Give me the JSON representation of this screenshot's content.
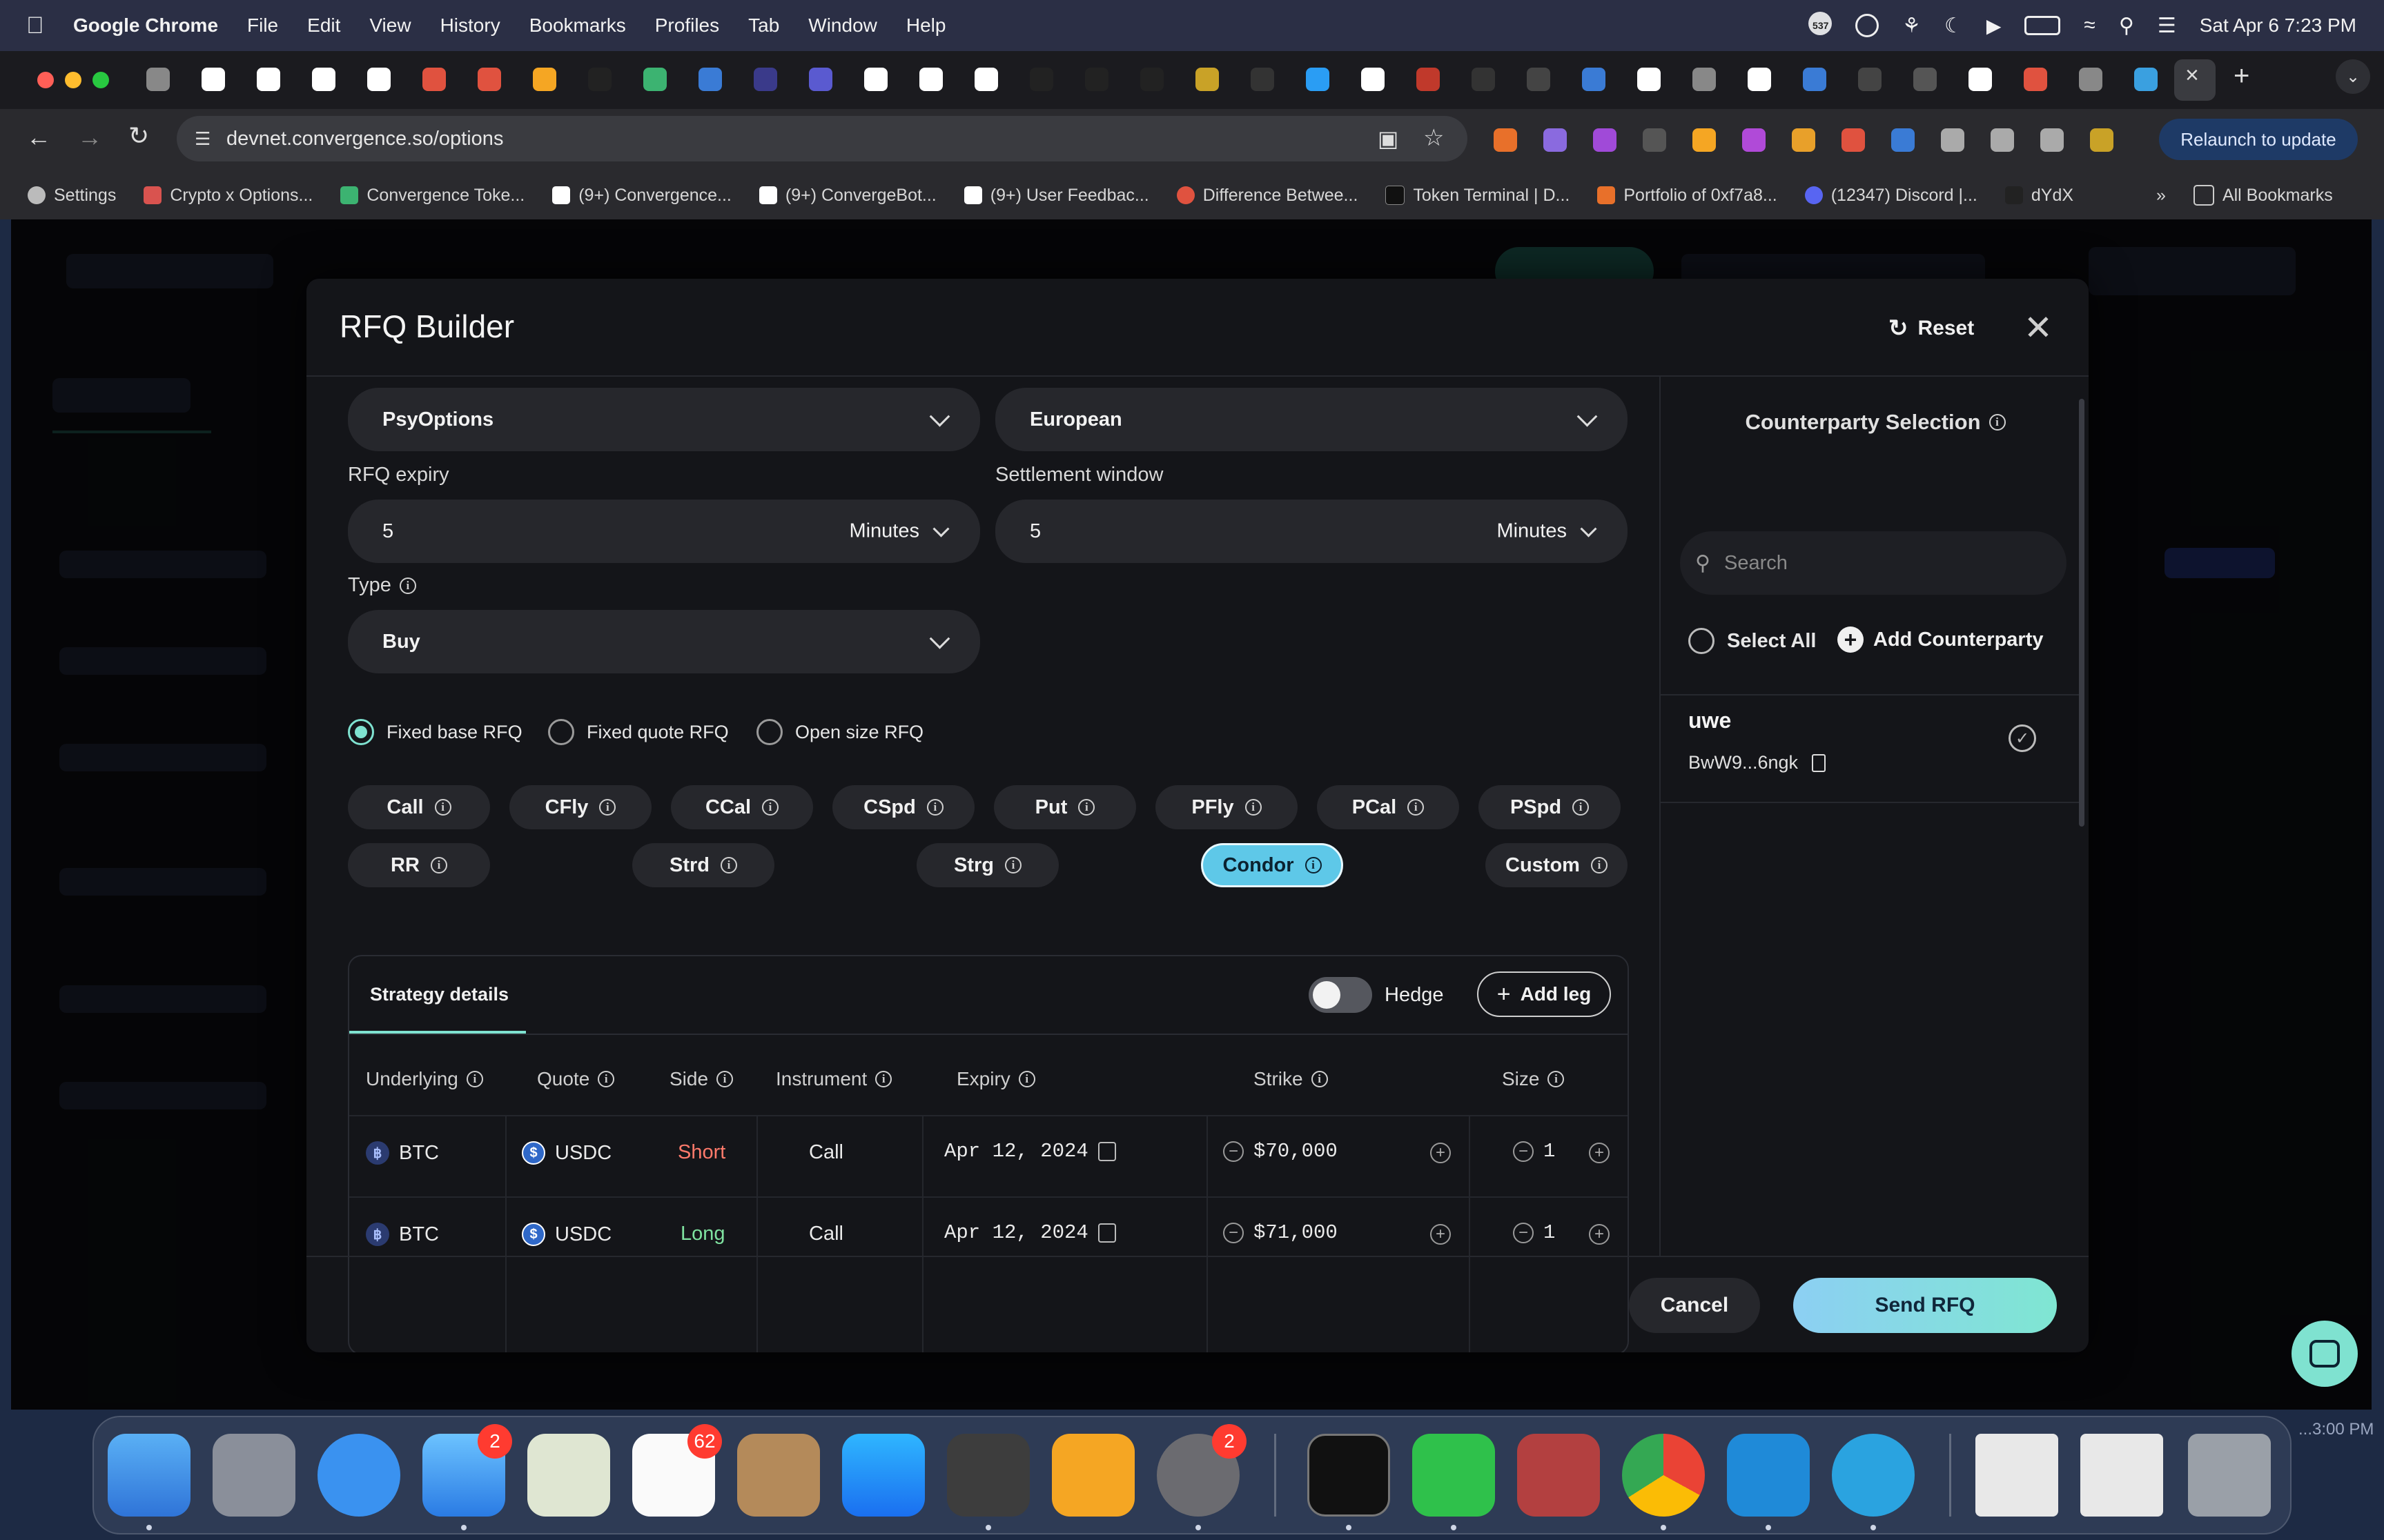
{
  "menubar": {
    "app": "Google Chrome",
    "items": [
      "File",
      "Edit",
      "View",
      "History",
      "Bookmarks",
      "Profiles",
      "Tab",
      "Window",
      "Help"
    ],
    "clock": "Sat Apr 6  7:23 PM",
    "badge": "537"
  },
  "browser": {
    "url": "devnet.convergence.so/options",
    "relaunch": "Relaunch to update",
    "bookmarks": [
      "Settings",
      "Crypto x Options...",
      "Convergence Toke...",
      "(9+) Convergence...",
      "(9+) ConvergeBot...",
      "(9+) User Feedbac...",
      "Difference Betwee...",
      "Token Terminal | D...",
      "Portfolio of 0xf7a8...",
      "(12347) Discord |...",
      "dYdX"
    ],
    "all_bookmarks": "All Bookmarks"
  },
  "modal": {
    "title": "RFQ Builder",
    "reset": "Reset",
    "protocol": "PsyOptions",
    "style": "European",
    "rfq_expiry_label": "RFQ expiry",
    "rfq_expiry_value": "5",
    "rfq_expiry_unit": "Minutes",
    "settlement_label": "Settlement window",
    "settlement_value": "5",
    "settlement_unit": "Minutes",
    "type_label": "Type",
    "type_value": "Buy",
    "size_modes": [
      "Fixed base RFQ",
      "Fixed quote RFQ",
      "Open size RFQ"
    ],
    "selected_size_mode": "Fixed base RFQ",
    "strategies_row1": [
      "Call",
      "CFly",
      "CCal",
      "CSpd",
      "Put",
      "PFly",
      "PCal",
      "PSpd"
    ],
    "strategies_row2": [
      "RR",
      "Strd",
      "Strg",
      "Condor",
      "Custom"
    ],
    "active_strategy": "Condor",
    "details_tab": "Strategy details",
    "hedge_label": "Hedge",
    "add_leg": "Add leg",
    "columns": [
      "Underlying",
      "Quote",
      "Side",
      "Instrument",
      "Expiry",
      "Strike",
      "Size"
    ],
    "legs": [
      {
        "underlying": "BTC",
        "quote": "USDC",
        "side": "Short",
        "instrument": "Call",
        "expiry": "Apr 12, 2024",
        "strike": "$70,000",
        "size": "1"
      },
      {
        "underlying": "BTC",
        "quote": "USDC",
        "side": "Long",
        "instrument": "Call",
        "expiry": "Apr 12, 2024",
        "strike": "$71,000",
        "size": "1"
      }
    ],
    "counterparty_title": "Counterparty Selection",
    "search_placeholder": "Search",
    "select_all": "Select All",
    "add_counterparty": "Add Counterparty",
    "counterparty_name": "uwe",
    "counterparty_addr": "BwW9...6ngk",
    "cancel": "Cancel",
    "send": "Send RFQ"
  },
  "dock": {
    "mail_badge": "2",
    "reminders_badge": "62",
    "settings_badge": "2",
    "time_peek": "...3:00 PM"
  },
  "colors": {
    "accent": "#7fe2d0",
    "short": "#ff7a6b",
    "long": "#7fe2a0",
    "active_chip": "#5ec8e8"
  }
}
